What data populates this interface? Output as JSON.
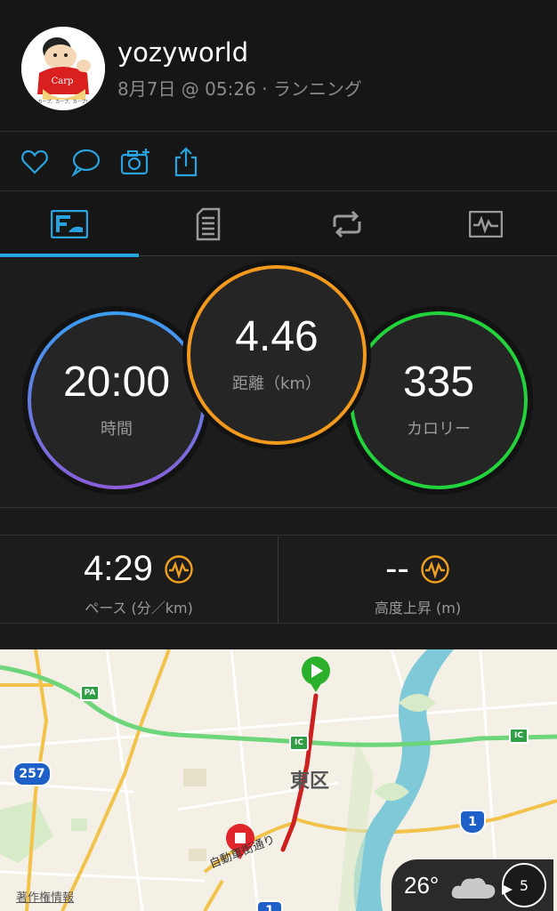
{
  "header": {
    "username": "yozyworld",
    "meta": "8月7日 @ 05:26 · ランニング",
    "avatar_text": "Carp",
    "avatar_caption": "カープ、カープ、カープ！"
  },
  "actions": [
    "heart-icon",
    "comment-icon",
    "add-photo-icon",
    "share-icon"
  ],
  "tabs": [
    "summary-icon",
    "details-icon",
    "laps-icon",
    "chart-icon"
  ],
  "colors": {
    "accent": "#29a3e0",
    "time_ring": [
      "#3b9cf0",
      "#8a5fd8"
    ],
    "distance_ring": "#f39a1e",
    "calories_ring": "#22d33c",
    "orange": "#f0a020",
    "route": "#cc1f1f"
  },
  "stats": {
    "time": {
      "value": "20:00",
      "label": "時間"
    },
    "distance": {
      "value": "4.46",
      "label": "距離（km）"
    },
    "calories": {
      "value": "335",
      "label": "カロリー"
    }
  },
  "metrics": {
    "pace": {
      "value": "4:29",
      "label": "ペース (分／km)"
    },
    "elevation": {
      "value": "--",
      "label": "高度上昇 (m)"
    }
  },
  "map": {
    "district": "東区",
    "road_label": "自動車街通り",
    "copyright": "著作権情報",
    "shields": {
      "pa": "PA",
      "ic": "IC",
      "r257": "257",
      "r1": "1"
    }
  },
  "weather": {
    "temp": "26°",
    "wind": "5"
  }
}
